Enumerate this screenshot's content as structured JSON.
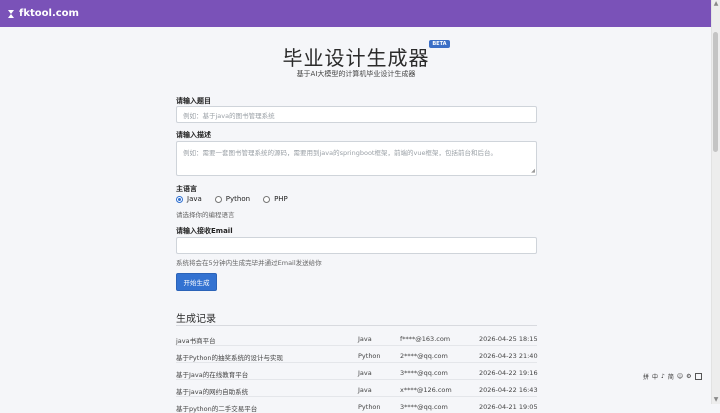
{
  "header": {
    "logo_text": "fktool.com"
  },
  "page": {
    "title": "毕业设计生成器",
    "badge": "BETA",
    "subtitle": "基于AI大模型的计算机毕业设计生成器"
  },
  "form": {
    "topic_label": "请输入题目",
    "topic_placeholder": "例如：基于java的图书管理系统",
    "desc_label": "请输入描述",
    "desc_placeholder": "例如：需要一套图书管理系统的源码，需要用到java的springboot框架，前端的vue框架，包括前台和后台。",
    "lang_label": "主语言",
    "lang_options": [
      "Java",
      "Python",
      "PHP"
    ],
    "lang_selected": "Java",
    "lang_help": "请选择你的编程语言",
    "email_label": "请输入接收Email",
    "email_value": "",
    "email_help": "系统将会在5分钟内生成完毕并通过Email发送给你",
    "submit_label": "开始生成"
  },
  "records": {
    "title": "生成记录",
    "rows": [
      {
        "name": "java书商平台",
        "lang": "Java",
        "email": "f****@163.com",
        "time": "2026-04-25 18:15"
      },
      {
        "name": "基于Python的抽奖系统的设计与实现",
        "lang": "Python",
        "email": "2****@qq.com",
        "time": "2026-04-23 21:40"
      },
      {
        "name": "基于Java的在线教育平台",
        "lang": "Java",
        "email": "3****@qq.com",
        "time": "2026-04-22 19:16"
      },
      {
        "name": "基于java的网约自助系统",
        "lang": "Java",
        "email": "x****@126.com",
        "time": "2026-04-22 16:43"
      },
      {
        "name": "基于python的二手交易平台",
        "lang": "Python",
        "email": "3****@qq.com",
        "time": "2026-04-21 19:05"
      }
    ]
  },
  "floating_toolbar": [
    "拼",
    "中",
    "♪",
    "简",
    "☺",
    "⚙"
  ],
  "colors": {
    "header": "#7a52b8",
    "primary": "#3372d1",
    "badge": "#3b6fc6"
  }
}
